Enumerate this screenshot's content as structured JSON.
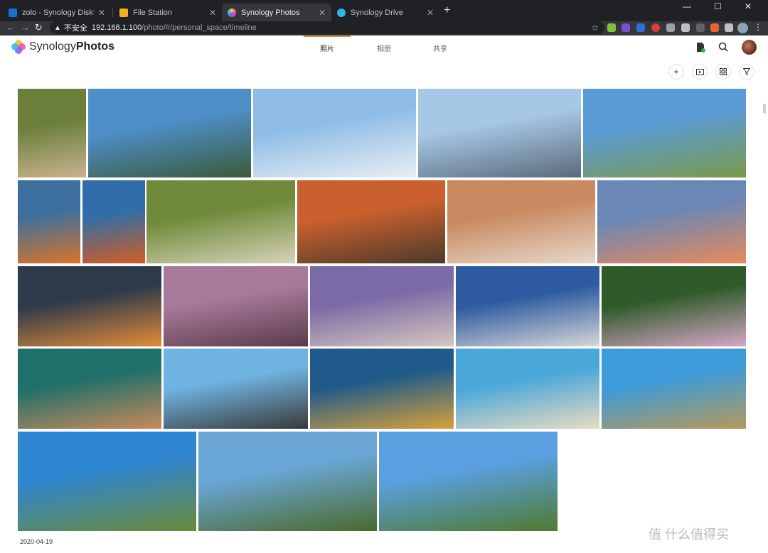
{
  "browser": {
    "tabs": [
      {
        "label": "zolo - Synology DiskStation",
        "favicon_color": "#1b6fd1",
        "active": false
      },
      {
        "label": "File Station",
        "favicon_color": "#f3b21b",
        "active": false
      },
      {
        "label": "Synology Photos",
        "favicon_color": "#e84d9c",
        "active": true
      },
      {
        "label": "Synology Drive",
        "favicon_color": "#2cb5e8",
        "active": false
      }
    ],
    "new_tab_icon": "plus-icon",
    "window_controls": [
      "minimize-icon",
      "maximize-icon",
      "close-icon"
    ],
    "insecure_label": "不安全",
    "url_host": "192.168.1.100",
    "url_path": "/photo/#/personal_space/timeline"
  },
  "app": {
    "brand_light": "Synology",
    "brand_bold": "Photos",
    "nav_tabs": [
      {
        "label": "照片",
        "active": true
      },
      {
        "label": "相册",
        "active": false
      },
      {
        "label": "共享",
        "active": false
      }
    ],
    "accent_color": "#f08a3a",
    "header_icons": [
      "task-icon",
      "search-icon"
    ],
    "actions": [
      "add-icon",
      "slideshow-icon",
      "grid-view-icon",
      "filter-icon"
    ]
  },
  "timeline": {
    "date": "2020-04-19",
    "photos": [
      {
        "subject": "barnacles-in-hand",
        "c1": "#6b7e3a",
        "c2": "#c9b38f"
      },
      {
        "subject": "selfie-pier-peace-sign",
        "c1": "#4e8fc9",
        "c2": "#3a5a3a"
      },
      {
        "subject": "selfie-boardwalk",
        "c1": "#8fbde6",
        "c2": "#e9eef3"
      },
      {
        "subject": "selfie-boardwalk-2",
        "c1": "#a7c7e6",
        "c2": "#5a6b7a"
      },
      {
        "subject": "selfie-coast-road",
        "c1": "#5b9bd5",
        "c2": "#7a9a4a"
      },
      {
        "subject": "ferry-harbor",
        "c1": "#3c6f9e",
        "c2": "#d9742a"
      },
      {
        "subject": "boat-deck",
        "c1": "#2f6ea8",
        "c2": "#d35c24"
      },
      {
        "subject": "barnacles-dish",
        "c1": "#6f8a3a",
        "c2": "#d7d2b8"
      },
      {
        "subject": "crab-dish",
        "c1": "#c9602e",
        "c2": "#4b3a2a"
      },
      {
        "subject": "mantis-shrimp-dish",
        "c1": "#c98a62",
        "c2": "#e7d8c9"
      },
      {
        "subject": "sunset-pier",
        "c1": "#6b87b5",
        "c2": "#e88a5a"
      },
      {
        "subject": "sunset-sea",
        "c1": "#2c3a4a",
        "c2": "#e28b3a"
      },
      {
        "subject": "dried-fish",
        "c1": "#a77a9a",
        "c2": "#5a3b4a"
      },
      {
        "subject": "crab-closeup",
        "c1": "#7a6aa5",
        "c2": "#d7c6c0"
      },
      {
        "subject": "fish-market",
        "c1": "#2d5aa0",
        "c2": "#d7d7d7"
      },
      {
        "subject": "pink-berries",
        "c1": "#2f5a2a",
        "c2": "#d6a6c6"
      },
      {
        "subject": "waves-rocks",
        "c1": "#1f6f6a",
        "c2": "#c98a5a"
      },
      {
        "subject": "rock-silhouettes",
        "c1": "#6fb3e0",
        "c2": "#3a3a3a"
      },
      {
        "subject": "coral-underwater",
        "c1": "#1f5a8a",
        "c2": "#d9a13a"
      },
      {
        "subject": "beach-kids",
        "c1": "#4aa7d9",
        "c2": "#e9dcc2"
      },
      {
        "subject": "beach-tents",
        "c1": "#3d9bd9",
        "c2": "#b59a5a"
      },
      {
        "subject": "street-palms",
        "c1": "#2f86d0",
        "c2": "#6a8a3a"
      },
      {
        "subject": "walkway-family",
        "c1": "#6aa6d6",
        "c2": "#4a6a2a"
      },
      {
        "subject": "plaza-umbrella",
        "c1": "#5aa0e0",
        "c2": "#4f7a2f"
      }
    ]
  },
  "watermark": "值 什么值得买"
}
